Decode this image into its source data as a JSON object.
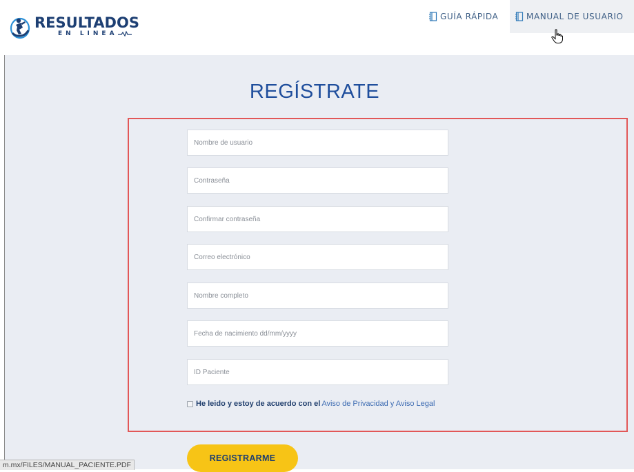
{
  "header": {
    "logo_title": "RESULTADOS",
    "logo_subtitle": "EN LINEA",
    "nav": {
      "guide_label": "GUÍA RÁPIDA",
      "manual_label": "MANUAL DE USUARIO"
    }
  },
  "form": {
    "title": "REGÍSTRATE",
    "fields": {
      "username": "Nombre de usuario",
      "password": "Contraseña",
      "confirm_password": "Confirmar contraseña",
      "email": "Correo electrónico",
      "full_name": "Nombre completo",
      "birth_date": "Fecha de nacimiento dd/mm/yyyy",
      "patient_id": "ID Paciente"
    },
    "terms_text": "He leido y estoy de acuerdo con el",
    "terms_link": "Aviso de Privacidad y Aviso Legal",
    "submit_label": "REGISTRARME"
  },
  "statusbar": {
    "url": "m.mx/FILES/MANUAL_PACIENTE.PDF"
  },
  "colors": {
    "brand_blue": "#1d3f73",
    "title_blue": "#1f4e9c",
    "button_yellow": "#f7c416",
    "highlight_red": "#e25757",
    "page_bg": "#eaedf3"
  },
  "icons": [
    "logo-icon",
    "book-icon",
    "hand-cursor-icon",
    "heartbeat-icon"
  ]
}
